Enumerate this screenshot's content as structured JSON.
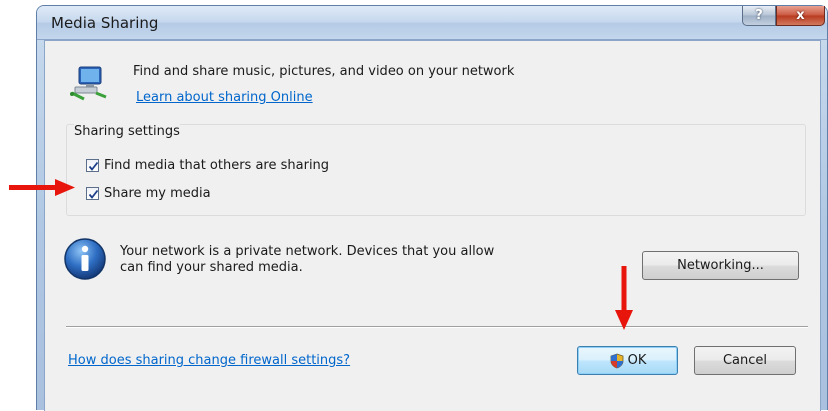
{
  "window": {
    "title": "Media Sharing",
    "help_glyph": "?",
    "close_glyph": "x"
  },
  "header": {
    "description": "Find and share music, pictures, and video on your network",
    "learn_link": "Learn about sharing Online",
    "icon": "network-computer-icon"
  },
  "sharing_settings": {
    "label": "Sharing settings",
    "options": [
      {
        "label": "Find media that others are sharing",
        "checked": true
      },
      {
        "label": "Share my media",
        "checked": true
      }
    ]
  },
  "info": {
    "icon": "info-icon",
    "line1": "Your network is a private network. Devices that you allow",
    "line2": "can find your shared media."
  },
  "buttons": {
    "networking": "Networking...",
    "ok": "OK",
    "cancel": "Cancel"
  },
  "footer": {
    "firewall_link": "How does sharing change firewall settings?"
  },
  "colors": {
    "annotation_arrow": "#e8150c",
    "link": "#0066cc"
  }
}
